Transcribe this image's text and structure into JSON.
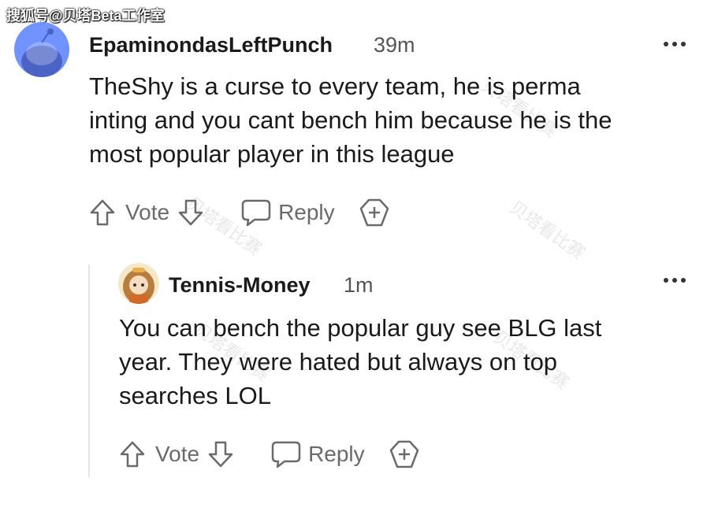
{
  "watermark": "搜狐号@贝塔Beta工作室",
  "bg_watermark": "贝塔看比赛",
  "colors": {
    "avatar1_bg": "#7193ff",
    "text": "#1a1a1b",
    "muted": "#6a6a6a"
  },
  "comments": [
    {
      "username": "EpaminondasLeftPunch",
      "time": "39m",
      "lines": [
        "TheShy is a curse to every team, he is perma",
        "inting and you cant bench him because he is the",
        "most popular player in this league"
      ],
      "vote_label": "Vote",
      "reply_label": "Reply",
      "icons": [
        "snoo-avatar-icon",
        "upvote-icon",
        "downvote-icon",
        "reply-bubble-icon",
        "award-plus-icon",
        "more-options-icon"
      ]
    },
    {
      "username": "Tennis-Money",
      "time": "1m",
      "lines": [
        "You can bench the popular guy see BLG last",
        "year. They were hated but always on top",
        "searches LOL"
      ],
      "vote_label": "Vote",
      "reply_label": "Reply",
      "icons": [
        "anime-avatar-icon",
        "upvote-icon",
        "downvote-icon",
        "reply-bubble-icon",
        "award-plus-icon",
        "more-options-icon"
      ]
    }
  ]
}
